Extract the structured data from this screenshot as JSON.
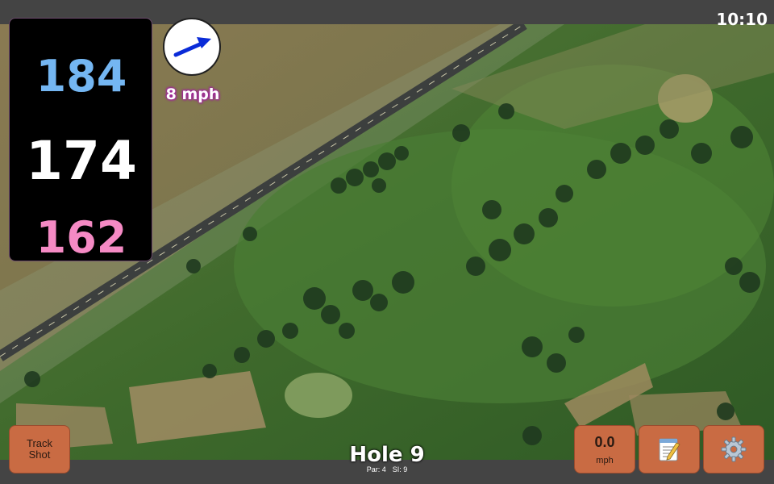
{
  "status_bar": {
    "time": "10:10"
  },
  "distances": {
    "back": "184",
    "middle": "174",
    "front": "162"
  },
  "wind": {
    "speed_label": "8 mph",
    "icon": "wind-arrow-icon"
  },
  "hole": {
    "title": "Hole 9",
    "par_label": "Par: 4",
    "si_label": "SI: 9"
  },
  "buttons": {
    "track_shot_label": "Track Shot",
    "speed_value": "0.0",
    "speed_unit": "mph",
    "notes_icon": "notepad-icon",
    "settings_icon": "gear-icon"
  },
  "colors": {
    "back_distance": "#74b6f2",
    "middle_distance": "#ffffff",
    "front_distance": "#f58ac4",
    "button_bg": "#c96b43",
    "wind_text_glow": "#a0289a"
  }
}
